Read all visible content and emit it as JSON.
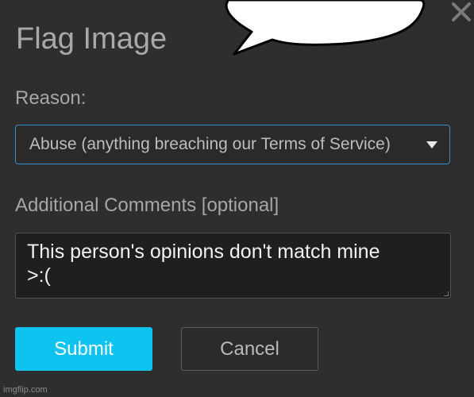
{
  "dialog": {
    "title": "Flag Image"
  },
  "form": {
    "reason_label": "Reason:",
    "reason_selected": "Abuse (anything breaching our Terms of Service)",
    "comments_label": "Additional Comments [optional]",
    "comments_value": "This person's opinions don't match mine\n>:("
  },
  "buttons": {
    "submit_label": "Submit",
    "cancel_label": "Cancel"
  },
  "icons": {
    "close": "close-icon",
    "dropdown": "chevron-down-icon"
  },
  "watermark": "imgflip.com",
  "colors": {
    "background": "#2e2e2e",
    "submit": "#0fc3f1",
    "select_border": "#2d8fcf",
    "text_muted": "#a9a9a9"
  }
}
